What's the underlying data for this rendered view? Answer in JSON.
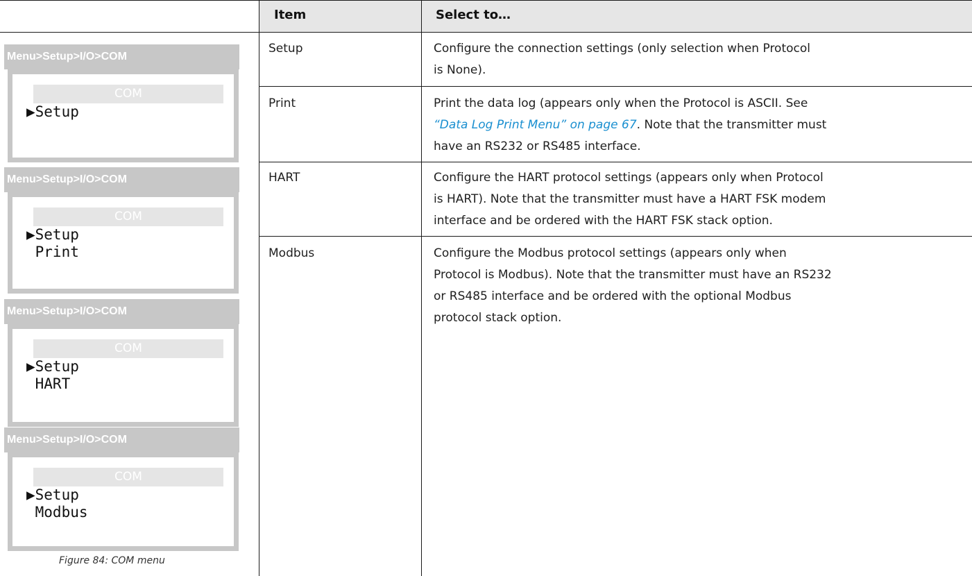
{
  "screens": [
    {
      "path": "Menu>Setup>I/O>COM",
      "title": "COM",
      "lines": [
        "▶Setup"
      ]
    },
    {
      "path": "Menu>Setup>I/O>COM",
      "title": "COM",
      "lines": [
        "▶Setup",
        " Print"
      ]
    },
    {
      "path": "Menu>Setup>I/O>COM",
      "title": "COM",
      "lines": [
        "▶Setup",
        " HART"
      ]
    },
    {
      "path": "Menu>Setup>I/O>COM",
      "title": "COM",
      "lines": [
        "▶Setup",
        " Modbus"
      ]
    }
  ],
  "figure_caption": "Figure 84:  COM menu",
  "table": {
    "headers": {
      "item": "Item",
      "select": "Select to…"
    },
    "rows": [
      {
        "item": "Setup",
        "lines": [
          "Configure the connection settings (only selection when Protocol",
          "is None)."
        ]
      },
      {
        "item": "Print",
        "line1": "Print the data log (appears only when the Protocol is ASCII. See",
        "link": "“Data Log Print Menu” on page 67",
        "line2_after": ". Note that the transmitter must",
        "line3": "have an RS232 or RS485 interface."
      },
      {
        "item": "HART",
        "lines": [
          "Configure the HART protocol settings (appears only when Protocol",
          "is HART). Note that the transmitter must have a HART FSK modem",
          "interface and be ordered with the HART FSK stack option."
        ]
      },
      {
        "item": "Modbus",
        "lines": [
          "Configure the Modbus protocol settings (appears only when",
          "Protocol is Modbus). Note that the transmitter must have an RS232",
          "or RS485 interface and be ordered with the optional Modbus",
          "protocol stack option."
        ]
      }
    ]
  },
  "colors": {
    "header_bg": "#e6e6e6",
    "screen_gray": "#c7c7c7",
    "link": "#1a8fd0"
  }
}
